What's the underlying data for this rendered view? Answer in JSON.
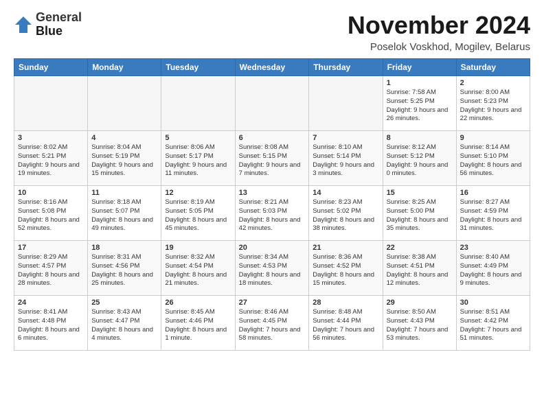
{
  "header": {
    "logo_line1": "General",
    "logo_line2": "Blue",
    "month_title": "November 2024",
    "location": "Poselok Voskhod, Mogilev, Belarus"
  },
  "weekdays": [
    "Sunday",
    "Monday",
    "Tuesday",
    "Wednesday",
    "Thursday",
    "Friday",
    "Saturday"
  ],
  "weeks": [
    [
      {
        "day": "",
        "info": ""
      },
      {
        "day": "",
        "info": ""
      },
      {
        "day": "",
        "info": ""
      },
      {
        "day": "",
        "info": ""
      },
      {
        "day": "",
        "info": ""
      },
      {
        "day": "1",
        "info": "Sunrise: 7:58 AM\nSunset: 5:25 PM\nDaylight: 9 hours\nand 26 minutes."
      },
      {
        "day": "2",
        "info": "Sunrise: 8:00 AM\nSunset: 5:23 PM\nDaylight: 9 hours\nand 22 minutes."
      }
    ],
    [
      {
        "day": "3",
        "info": "Sunrise: 8:02 AM\nSunset: 5:21 PM\nDaylight: 9 hours\nand 19 minutes."
      },
      {
        "day": "4",
        "info": "Sunrise: 8:04 AM\nSunset: 5:19 PM\nDaylight: 9 hours\nand 15 minutes."
      },
      {
        "day": "5",
        "info": "Sunrise: 8:06 AM\nSunset: 5:17 PM\nDaylight: 9 hours\nand 11 minutes."
      },
      {
        "day": "6",
        "info": "Sunrise: 8:08 AM\nSunset: 5:15 PM\nDaylight: 9 hours\nand 7 minutes."
      },
      {
        "day": "7",
        "info": "Sunrise: 8:10 AM\nSunset: 5:14 PM\nDaylight: 9 hours\nand 3 minutes."
      },
      {
        "day": "8",
        "info": "Sunrise: 8:12 AM\nSunset: 5:12 PM\nDaylight: 9 hours\nand 0 minutes."
      },
      {
        "day": "9",
        "info": "Sunrise: 8:14 AM\nSunset: 5:10 PM\nDaylight: 8 hours\nand 56 minutes."
      }
    ],
    [
      {
        "day": "10",
        "info": "Sunrise: 8:16 AM\nSunset: 5:08 PM\nDaylight: 8 hours\nand 52 minutes."
      },
      {
        "day": "11",
        "info": "Sunrise: 8:18 AM\nSunset: 5:07 PM\nDaylight: 8 hours\nand 49 minutes."
      },
      {
        "day": "12",
        "info": "Sunrise: 8:19 AM\nSunset: 5:05 PM\nDaylight: 8 hours\nand 45 minutes."
      },
      {
        "day": "13",
        "info": "Sunrise: 8:21 AM\nSunset: 5:03 PM\nDaylight: 8 hours\nand 42 minutes."
      },
      {
        "day": "14",
        "info": "Sunrise: 8:23 AM\nSunset: 5:02 PM\nDaylight: 8 hours\nand 38 minutes."
      },
      {
        "day": "15",
        "info": "Sunrise: 8:25 AM\nSunset: 5:00 PM\nDaylight: 8 hours\nand 35 minutes."
      },
      {
        "day": "16",
        "info": "Sunrise: 8:27 AM\nSunset: 4:59 PM\nDaylight: 8 hours\nand 31 minutes."
      }
    ],
    [
      {
        "day": "17",
        "info": "Sunrise: 8:29 AM\nSunset: 4:57 PM\nDaylight: 8 hours\nand 28 minutes."
      },
      {
        "day": "18",
        "info": "Sunrise: 8:31 AM\nSunset: 4:56 PM\nDaylight: 8 hours\nand 25 minutes."
      },
      {
        "day": "19",
        "info": "Sunrise: 8:32 AM\nSunset: 4:54 PM\nDaylight: 8 hours\nand 21 minutes."
      },
      {
        "day": "20",
        "info": "Sunrise: 8:34 AM\nSunset: 4:53 PM\nDaylight: 8 hours\nand 18 minutes."
      },
      {
        "day": "21",
        "info": "Sunrise: 8:36 AM\nSunset: 4:52 PM\nDaylight: 8 hours\nand 15 minutes."
      },
      {
        "day": "22",
        "info": "Sunrise: 8:38 AM\nSunset: 4:51 PM\nDaylight: 8 hours\nand 12 minutes."
      },
      {
        "day": "23",
        "info": "Sunrise: 8:40 AM\nSunset: 4:49 PM\nDaylight: 8 hours\nand 9 minutes."
      }
    ],
    [
      {
        "day": "24",
        "info": "Sunrise: 8:41 AM\nSunset: 4:48 PM\nDaylight: 8 hours\nand 6 minutes."
      },
      {
        "day": "25",
        "info": "Sunrise: 8:43 AM\nSunset: 4:47 PM\nDaylight: 8 hours\nand 4 minutes."
      },
      {
        "day": "26",
        "info": "Sunrise: 8:45 AM\nSunset: 4:46 PM\nDaylight: 8 hours\nand 1 minute."
      },
      {
        "day": "27",
        "info": "Sunrise: 8:46 AM\nSunset: 4:45 PM\nDaylight: 7 hours\nand 58 minutes."
      },
      {
        "day": "28",
        "info": "Sunrise: 8:48 AM\nSunset: 4:44 PM\nDaylight: 7 hours\nand 56 minutes."
      },
      {
        "day": "29",
        "info": "Sunrise: 8:50 AM\nSunset: 4:43 PM\nDaylight: 7 hours\nand 53 minutes."
      },
      {
        "day": "30",
        "info": "Sunrise: 8:51 AM\nSunset: 4:42 PM\nDaylight: 7 hours\nand 51 minutes."
      }
    ]
  ]
}
